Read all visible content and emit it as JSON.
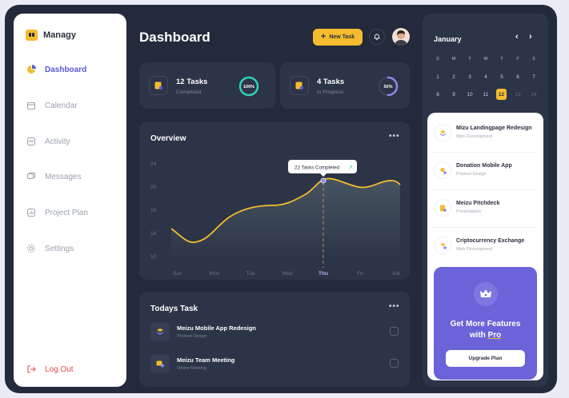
{
  "brand": {
    "name": "Managy"
  },
  "sidebar": {
    "items": [
      {
        "label": "Dashboard"
      },
      {
        "label": "Calendar"
      },
      {
        "label": "Activity"
      },
      {
        "label": "Messages"
      },
      {
        "label": "Project Plan"
      },
      {
        "label": "Settings"
      }
    ],
    "logout": "Log Out"
  },
  "header": {
    "title": "Dashboard",
    "new_task": "New Task"
  },
  "stats": [
    {
      "title": "12 Tasks",
      "sub": "Completed",
      "percent": "100%",
      "value": 1.0
    },
    {
      "title": "4 Tasks",
      "sub": "In Progress",
      "percent": "50%",
      "value": 0.5
    }
  ],
  "overview": {
    "title": "Overview",
    "more": "•••",
    "tooltip": "22 Tasks Completed",
    "y_ticks": [
      "24",
      "20",
      "16",
      "14",
      "10"
    ],
    "days": [
      "Sun",
      "Mon",
      "Tue",
      "Wed",
      "Thu",
      "Fri",
      "Sat"
    ]
  },
  "today": {
    "title": "Todays Task",
    "more": "•••",
    "tasks": [
      {
        "title": "Meizu Mobile App Redesign",
        "sub": "Product Design"
      },
      {
        "title": "Meizu Team Meeting",
        "sub": "Online Meeting"
      }
    ]
  },
  "calendar": {
    "month": "January",
    "prev": "‹",
    "next": "›",
    "weekdays": [
      "S",
      "M",
      "T",
      "W",
      "T",
      "F",
      "S"
    ],
    "weeks": [
      [
        "1",
        "2",
        "3",
        "4",
        "5",
        "6",
        "7"
      ],
      [
        "8",
        "9",
        "10",
        "11",
        "12",
        "13",
        "14"
      ]
    ],
    "selected": "12"
  },
  "projects": [
    {
      "title": "Mizu Landingpage Redesign",
      "sub": "Web Development"
    },
    {
      "title": "Donation Mobile App",
      "sub": "Product Design"
    },
    {
      "title": "Meizu Pitchdeck",
      "sub": "Presentation"
    },
    {
      "title": "Criptocurrency Exchange",
      "sub": "Web Development"
    }
  ],
  "promo": {
    "title_line1": "Get More Features",
    "title_with": "with ",
    "title_pro": "Pro",
    "button": "Upgrade Plan"
  },
  "colors": {
    "accent": "#f5bc2e",
    "primary": "#5b57d6",
    "bg": "#232a3b",
    "card": "#2c3447",
    "danger": "#e54b4b",
    "ring_done": "#2ed1b8",
    "ring_progress": "#8d88e6"
  }
}
